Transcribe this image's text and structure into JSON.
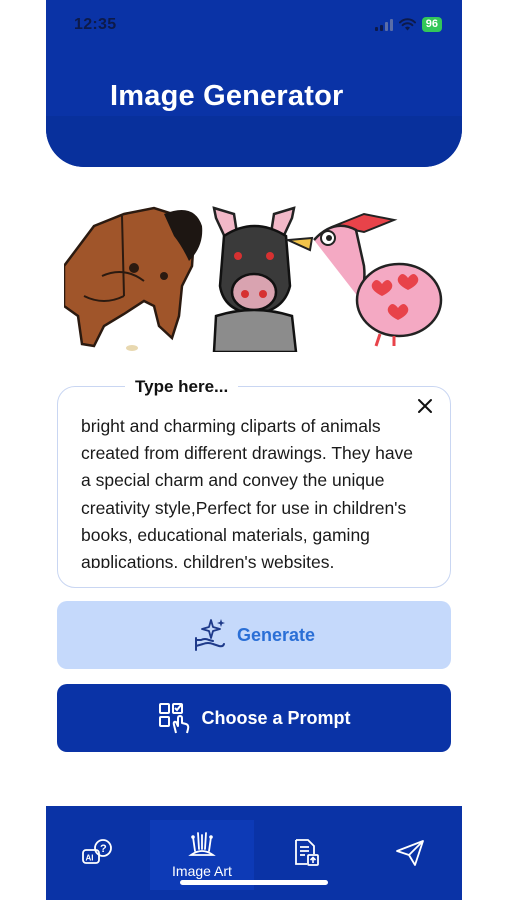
{
  "status_bar": {
    "time": "12:35",
    "battery": "96",
    "icons": [
      "signal-icon",
      "wifi-icon",
      "battery-icon"
    ]
  },
  "header": {
    "title": "Image Generator"
  },
  "preview": {
    "icon": "animal-cliparts-illustration"
  },
  "prompt": {
    "legend": "Type here...",
    "value": "bright and charming cliparts of animals created from different drawings. They have a special charm and convey the unique creativity style,Perfect for use in children's books, educational materials, gaming applications, children's websites,",
    "clear_icon": "close-icon"
  },
  "actions": {
    "generate_label": "Generate",
    "generate_icon": "sparkle-hand-icon",
    "choose_prompt_label": "Choose a Prompt",
    "choose_prompt_icon": "grid-select-icon"
  },
  "bottom_nav": {
    "items": [
      {
        "label": "",
        "icon": "ai-help-icon",
        "active": false
      },
      {
        "label": "Image Art",
        "icon": "image-art-icon",
        "active": true
      },
      {
        "label": "",
        "icon": "document-upload-icon",
        "active": false
      },
      {
        "label": "",
        "icon": "send-icon",
        "active": false
      }
    ]
  },
  "colors": {
    "primary": "#0a33a6",
    "generate_bg": "#c5d9fb",
    "generate_text": "#2a6fd6",
    "battery": "#33c759"
  }
}
